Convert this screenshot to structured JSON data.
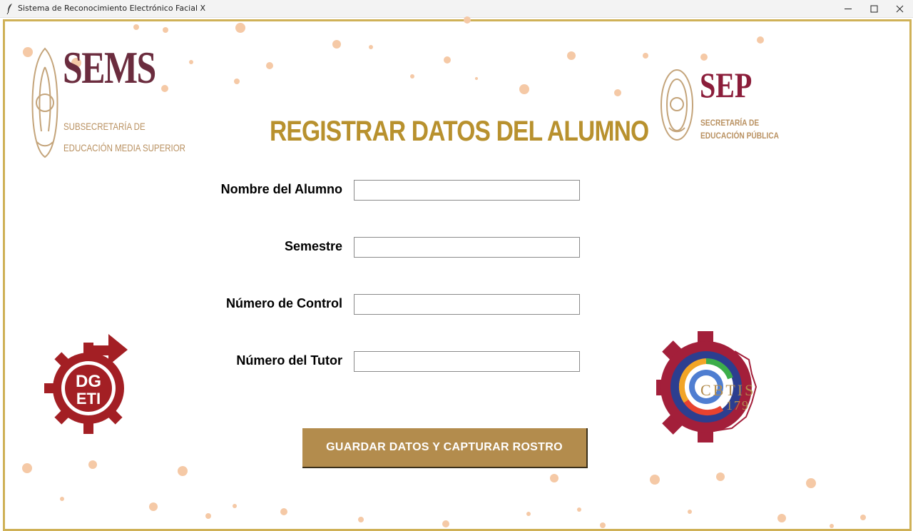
{
  "window": {
    "title": "Sistema de Reconocimiento Electrónico Facial X",
    "minimize_glyph": "—",
    "maximize_glyph": "☐",
    "close_glyph": "✕"
  },
  "logos": {
    "sems": {
      "title": "SEMS",
      "subtitle_line1": "SUBSECRETARÍA DE",
      "subtitle_line2": "EDUCACIÓN MEDIA SUPERIOR"
    },
    "sep": {
      "title": "SEP",
      "subtitle_line1": "SECRETARÍA DE",
      "subtitle_line2": "EDUCACIÓN PÚBLICA"
    },
    "dgeti": {
      "line1": "DG",
      "line2": "ETI"
    },
    "cbtis": {
      "name": "CBTIS",
      "number": "179"
    }
  },
  "form": {
    "title": "REGISTRAR DATOS DEL ALUMNO",
    "fields": [
      {
        "label": "Nombre del Alumno",
        "value": ""
      },
      {
        "label": "Semestre",
        "value": ""
      },
      {
        "label": "Número de Control",
        "value": ""
      },
      {
        "label": "Número del Tutor",
        "value": ""
      }
    ],
    "submit_label": "GUARDAR DATOS Y CAPTURAR ROSTRO"
  },
  "colors": {
    "frame_border": "#cfb157",
    "title_gold": "#b8912e",
    "button_bg": "#b38c4d",
    "dot_peach": "#f5c9a6",
    "dgeti_red": "#a31f24",
    "sems_maroon": "#6b2c3e",
    "sep_maroon": "#8b1d3a"
  }
}
